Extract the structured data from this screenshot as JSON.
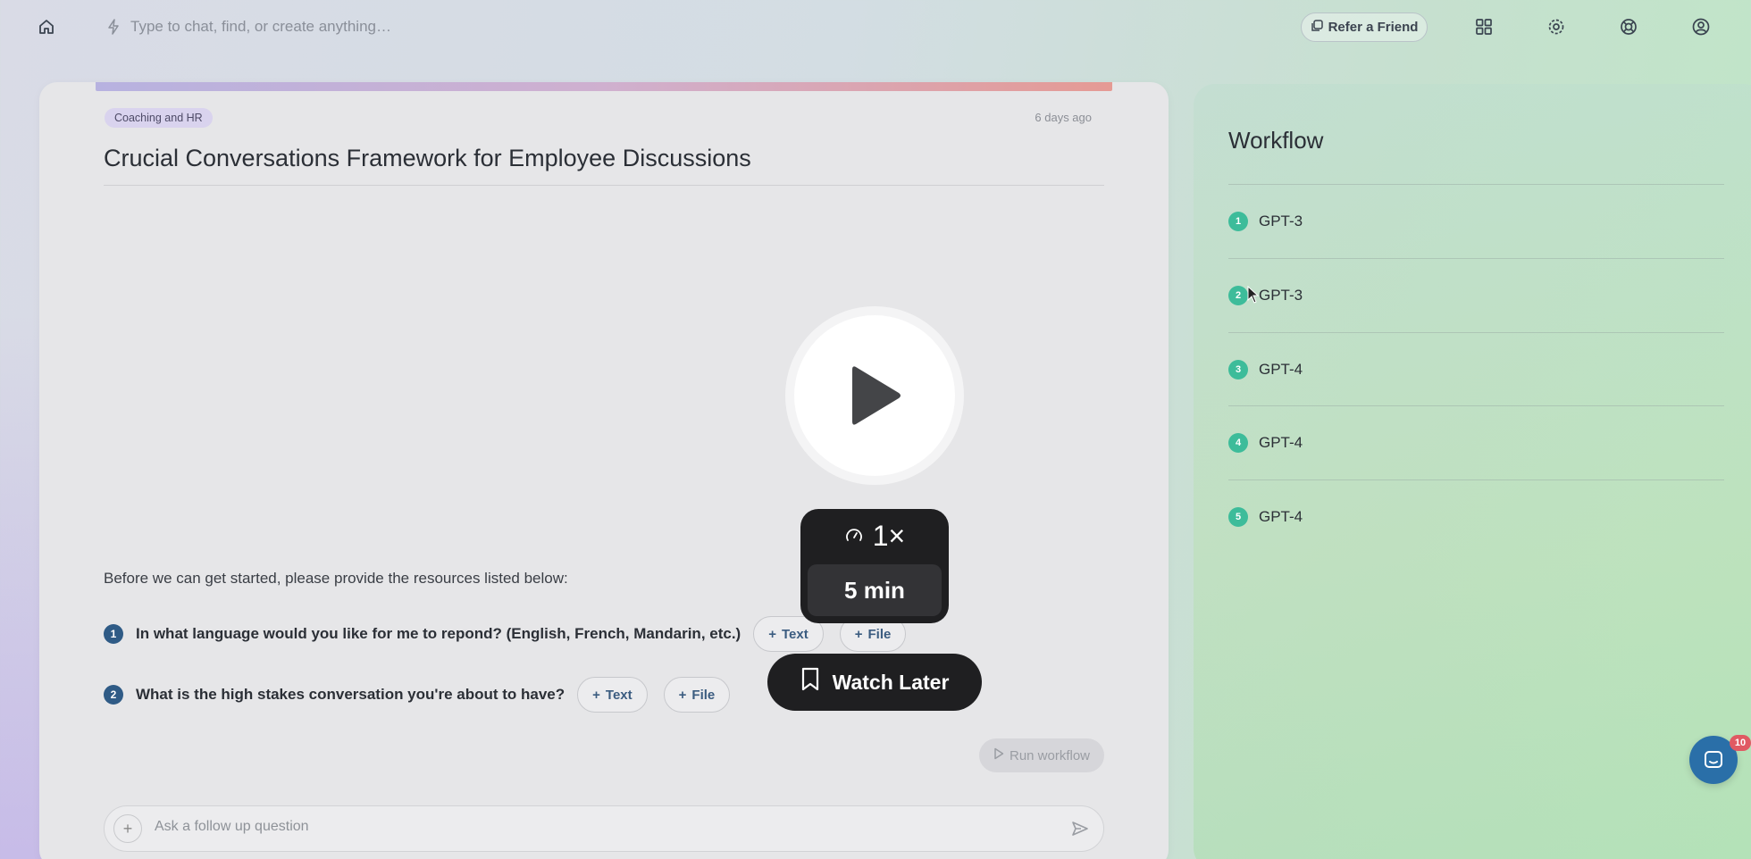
{
  "topbar": {
    "command_placeholder": "Type to chat, find, or create anything…",
    "refer_label": "Refer a Friend"
  },
  "main": {
    "tag": "Coaching and HR",
    "timestamp": "6 days ago",
    "title": "Crucial Conversations Framework for Employee Discussions",
    "intro": "Before we can get started, please provide the resources listed below:",
    "questions": [
      {
        "number": "1",
        "text": "In what language would you like for me to repond? (English, French, Mandarin, etc.)",
        "text_chip": "Text",
        "file_chip": "File"
      },
      {
        "number": "2",
        "text": "What is the high stakes conversation you're about to have?",
        "text_chip": "Text",
        "file_chip": "File"
      }
    ],
    "run_label": "Run workflow",
    "followup_placeholder": "Ask a follow up question"
  },
  "workflow": {
    "title": "Workflow",
    "steps": [
      {
        "number": "1",
        "label": "GPT-3"
      },
      {
        "number": "2",
        "label": "GPT-3"
      },
      {
        "number": "3",
        "label": "GPT-4"
      },
      {
        "number": "4",
        "label": "GPT-4"
      },
      {
        "number": "5",
        "label": "GPT-4"
      }
    ]
  },
  "video_overlay": {
    "speed": "1×",
    "duration": "5 min",
    "watch_later": "Watch Later"
  },
  "chat_widget": {
    "badge": "10"
  },
  "colors": {
    "accent_blue": "#2f5b86",
    "workflow_green": "#3dbc9a",
    "badge_red": "#e05a63"
  }
}
